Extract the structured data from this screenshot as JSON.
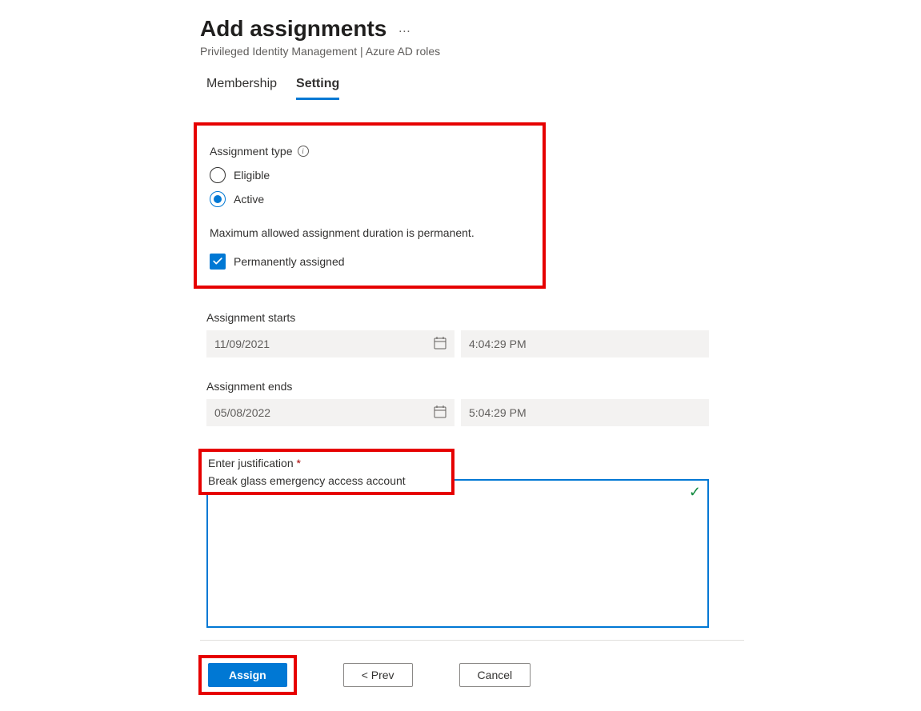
{
  "header": {
    "title": "Add assignments",
    "breadcrumb": "Privileged Identity Management | Azure AD roles"
  },
  "tabs": {
    "membership": "Membership",
    "setting": "Setting"
  },
  "assignment_type": {
    "label": "Assignment type",
    "eligible": "Eligible",
    "active": "Active",
    "duration_note": "Maximum allowed assignment duration is permanent.",
    "permanent_label": "Permanently assigned"
  },
  "starts": {
    "label": "Assignment starts",
    "date": "11/09/2021",
    "time": "4:04:29 PM"
  },
  "ends": {
    "label": "Assignment ends",
    "date": "05/08/2022",
    "time": "5:04:29 PM"
  },
  "justification": {
    "label": "Enter justification",
    "value": "Break glass emergency access account"
  },
  "buttons": {
    "assign": "Assign",
    "prev": "< Prev",
    "cancel": "Cancel"
  }
}
